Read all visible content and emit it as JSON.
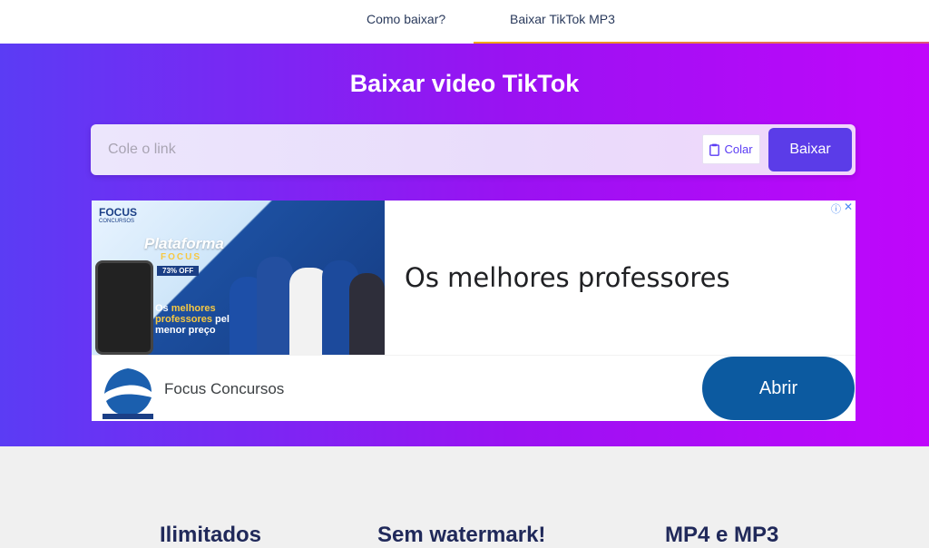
{
  "nav": {
    "how_to": "Como baixar?",
    "mp3": "Baixar TikTok MP3"
  },
  "hero": {
    "title": "Baixar video TikTok",
    "search_placeholder": "Cole o link",
    "paste_label": "Colar",
    "download_label": "Baixar"
  },
  "ad": {
    "logo": "FOCUS",
    "logo_sub": "CONCURSOS",
    "promo_title": "Plataforma",
    "promo_sub": "FOCUS",
    "promo_off": "73% OFF",
    "promo_line1": "Os ",
    "promo_hl1": "melhores",
    "promo_hl2": "professores",
    "promo_line2": " pelo",
    "promo_line3": "menor preço",
    "headline": "Os melhores professores",
    "brand_name": "Focus Concursos",
    "open_label": "Abrir",
    "info_icon": "info-icon",
    "close_icon": "close-icon"
  },
  "features": {
    "items": [
      "Ilimitados",
      "Sem watermark!",
      "MP4 e MP3"
    ]
  },
  "colors": {
    "hero_start": "#5b3cf4",
    "hero_end": "#c006fb",
    "button": "#5b3ce8",
    "ad_button": "#0c5aa0",
    "feature_text": "#20295a"
  }
}
